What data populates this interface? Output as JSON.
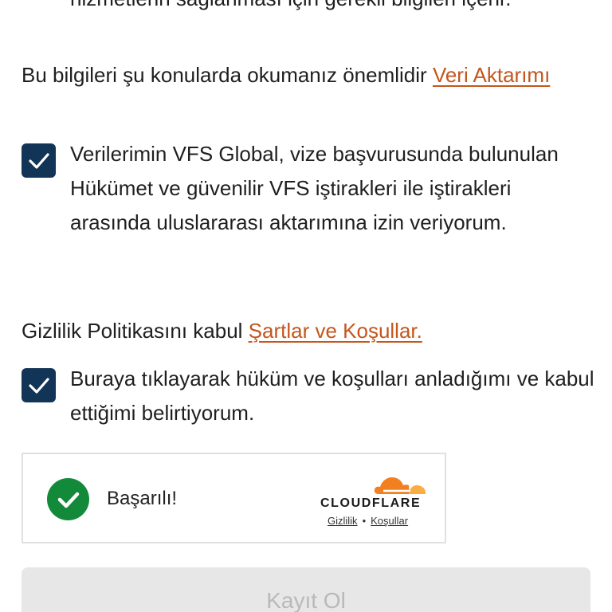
{
  "top_cut_text": "hizmetlerin sağlanması için gerekli bilgileri içerir.",
  "data_transfer": {
    "intro": "Bu bilgileri şu konularda okumanız önemlidir ",
    "link": "Veri Aktarımı",
    "checkbox_checked": true,
    "checkbox_label": "Verilerimin VFS Global, vize başvurusunda bulunulan Hükümet ve güvenilir VFS iştirakleri ile iştirakleri arasında uluslararası aktarımına izin veriyorum."
  },
  "privacy": {
    "intro": "Gizlilik Politikasını kabul ",
    "link": "Şartlar ve Koşullar.",
    "checkbox_checked": true,
    "checkbox_label": "Buraya tıklayarak hüküm ve koşulları anladığımı ve kabul ettiğimi belirtiyorum."
  },
  "captcha": {
    "status": "Başarılı!",
    "brand": "CLOUDFLARE",
    "privacy_link": "Gizlilik",
    "separator": "•",
    "terms_link": "Koşullar",
    "success_color": "#128a3a",
    "brand_color": "#f38020"
  },
  "submit_button": "Kayıt Ol",
  "colors": {
    "link": "#c5561c",
    "checkbox": "#123456",
    "button_disabled_bg": "#e7e7e7",
    "button_disabled_text": "#b9b9b9"
  },
  "icons": {
    "checkbox": "checkmark-icon",
    "captcha_success": "check-circle-icon",
    "brand_logo": "cloud-icon"
  }
}
